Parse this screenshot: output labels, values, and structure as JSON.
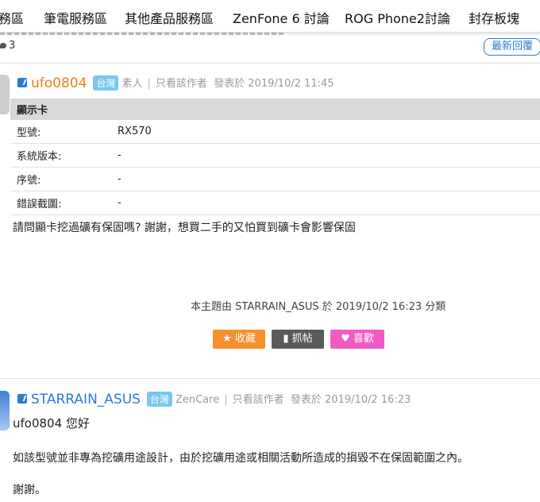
{
  "nav": {
    "items": [
      "務區",
      "筆電服務區",
      "其他產品服務區",
      "ZenFone 6 討論",
      "ROG Phone2討論",
      "封存板塊"
    ]
  },
  "thread": {
    "reply_count": "3",
    "latest_reply_label": "最新回覆"
  },
  "post1": {
    "username": "ufo0804",
    "region": "台灣",
    "rank": "素人",
    "only_author": "只看該作者",
    "posted": "發表於 2019/10/2 11:45",
    "spec": {
      "header": "顯示卡",
      "rows": [
        {
          "label": "型號:",
          "value": "RX570"
        },
        {
          "label": "系統版本:",
          "value": "-"
        },
        {
          "label": "序號:",
          "value": "-"
        },
        {
          "label": "錯誤截圖:",
          "value": "-"
        }
      ]
    },
    "content": "請問顯卡挖過礦有保固嗎? 謝謝，想買二手的又怕買到礦卡會影響保固",
    "moved_note": "本主題由 STARRAIN_ASUS 於 2019/10/2 16:23 分類",
    "buttons": {
      "favorite": "收藏",
      "grab": "抓帖",
      "like": "喜歡"
    }
  },
  "post2": {
    "username": "STARRAIN_ASUS",
    "region": "台灣",
    "rank": "ZenCare",
    "only_author": "只看該作者",
    "posted": "發表於 2019/10/2 16:23",
    "greeting": "ufo0804 您好",
    "paragraph": "如該型號並非專為挖礦用途設計，由於挖礦用途或相關活動所造成的損毀不在保固範圍之內。",
    "closing": "謝謝。"
  },
  "colors": {
    "accent_blue": "#2a7bd3",
    "user_orange": "#f07d10",
    "fav_orange": "#f5902f",
    "like_pink": "#f25ac3"
  }
}
